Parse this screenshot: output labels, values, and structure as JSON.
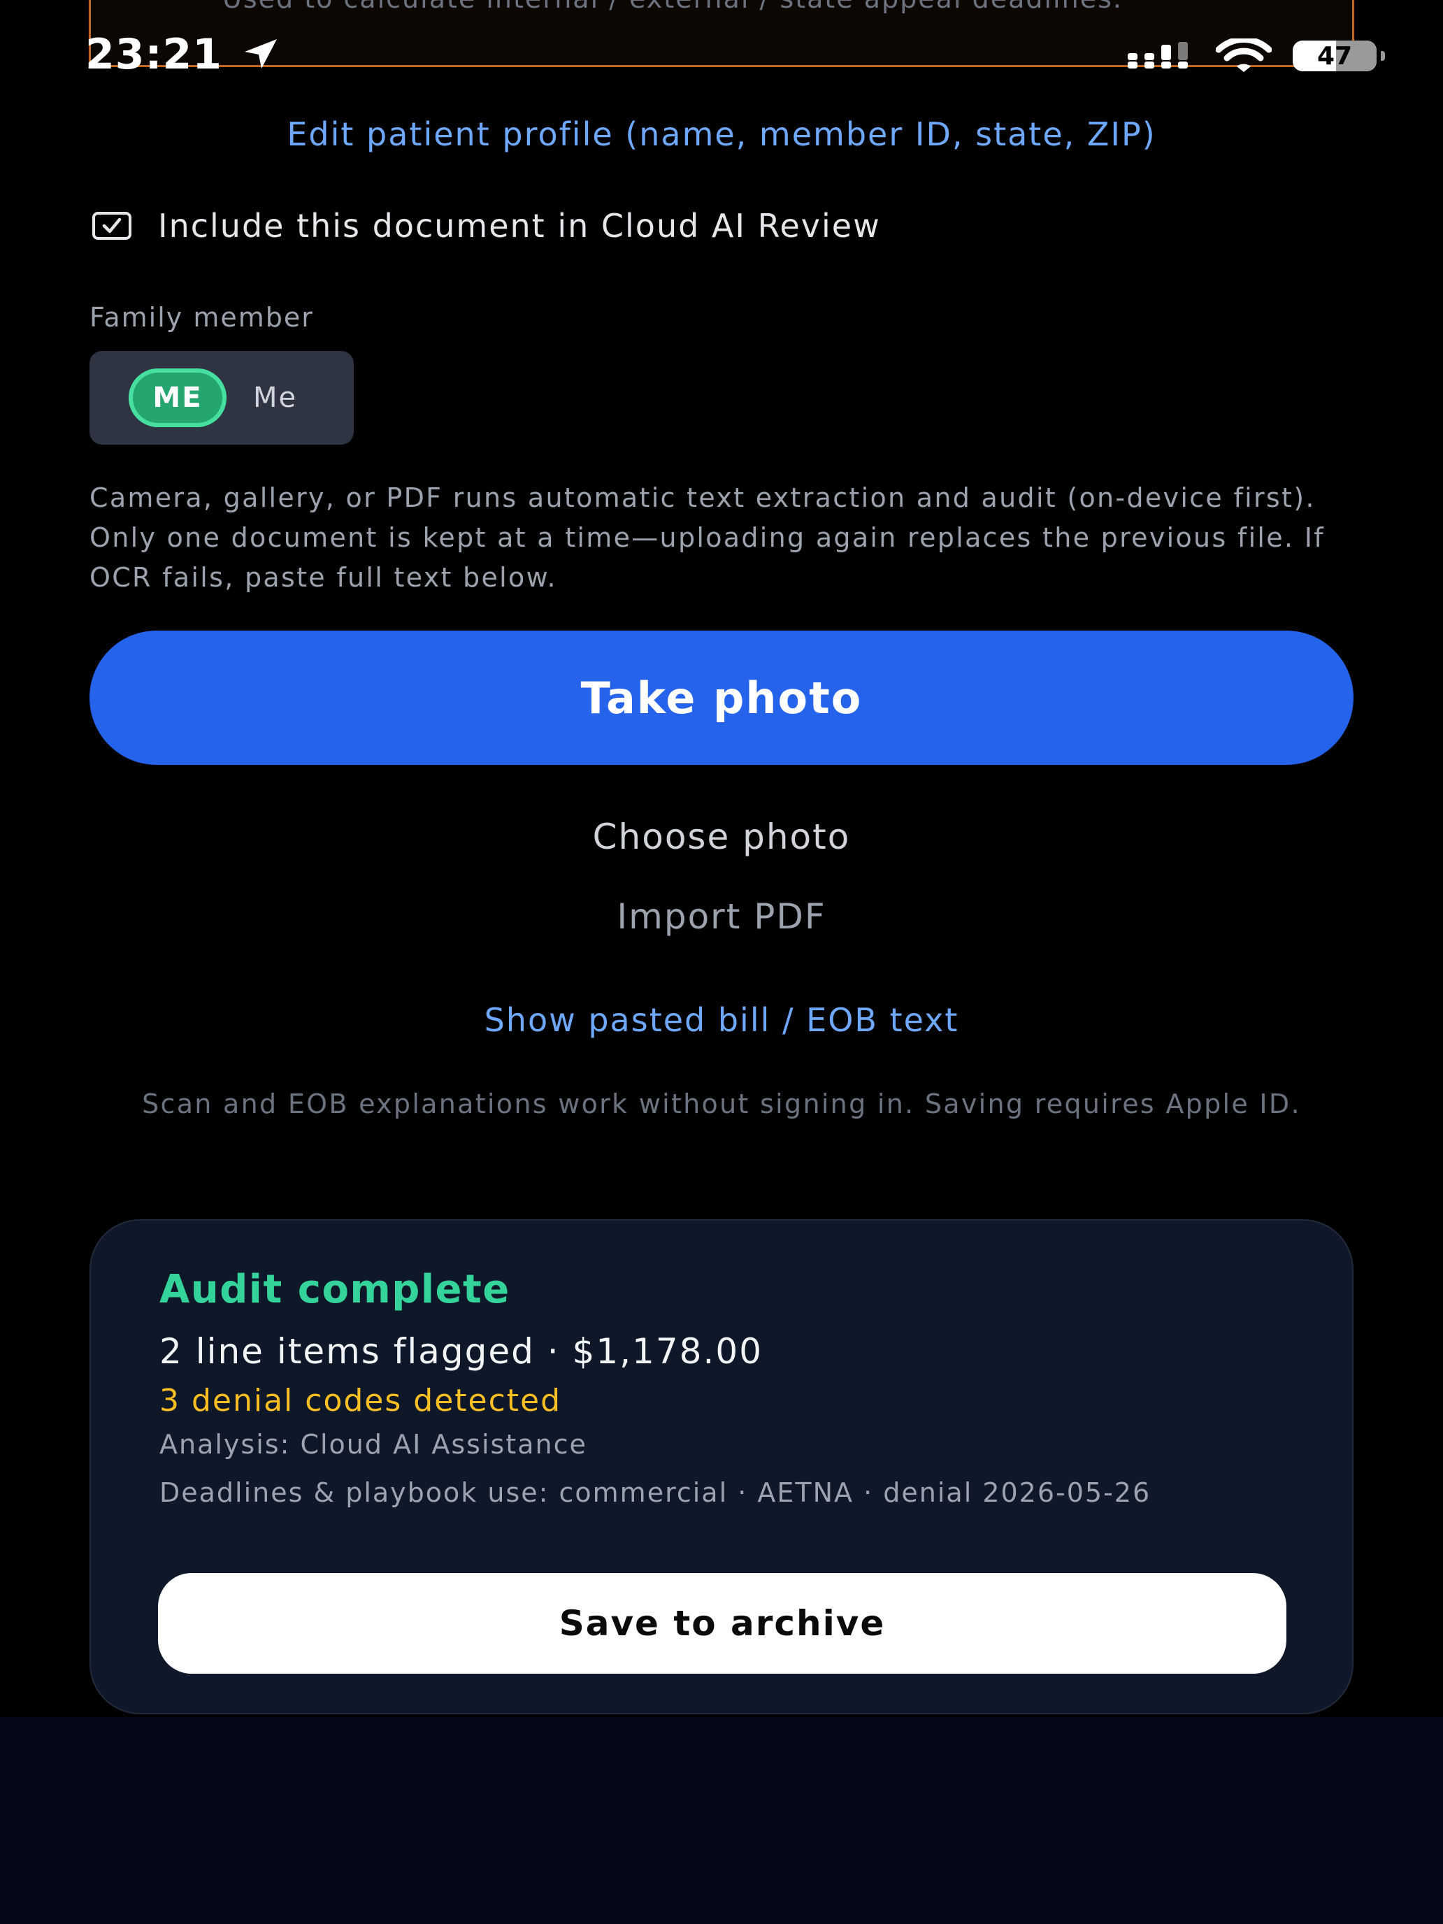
{
  "top_card": {
    "helper_text": "Used to calculate internal / external / state appeal deadlines."
  },
  "status_bar": {
    "time": "23:21",
    "location_icon": "location-arrow-icon",
    "signal_icon": "cellular-signal-icon",
    "wifi_icon": "wifi-icon",
    "battery_level": "47"
  },
  "profile": {
    "edit_link": "Edit patient profile (name, member ID, state, ZIP)"
  },
  "cloud_review": {
    "checked": true,
    "label": "Include this document in Cloud AI Review"
  },
  "family": {
    "label": "Family member",
    "selected": {
      "initials": "ME",
      "name": "Me"
    }
  },
  "upload": {
    "description": "Camera, gallery, or PDF runs automatic text extraction and audit (on-device first). Only one document is kept at a time—uploading again replaces the previous file. If OCR fails, paste full text below.",
    "take_photo": "Take photo",
    "choose_photo": "Choose photo",
    "import_pdf": "Import PDF",
    "show_pasted": "Show pasted bill / EOB text",
    "signin_note": "Scan and EOB explanations work without signing in. Saving requires Apple ID."
  },
  "audit": {
    "title": "Audit complete",
    "summary": "2 line items flagged · $1,178.00",
    "denial_codes": "3 denial codes detected",
    "analysis": "Analysis: Cloud AI Assistance",
    "deadlines": "Deadlines & playbook use: commercial · AETNA · denial 2026-05-26",
    "save_button": "Save to archive"
  },
  "colors": {
    "accent_blue": "#2563eb",
    "link_blue": "#6ea8ff",
    "success_green": "#34d399",
    "warning_amber": "#fbbf24",
    "card_border_orange": "#c2651e"
  }
}
